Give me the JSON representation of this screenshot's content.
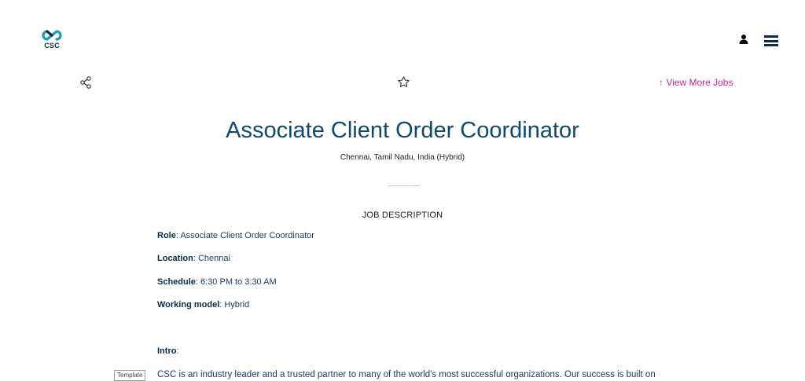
{
  "header": {
    "logo_text": "CSC",
    "user_icon": "user-icon",
    "menu_icon": "hamburger-menu-icon"
  },
  "toolbar": {
    "share_icon": "share-icon",
    "favorite_icon": "star-icon",
    "view_more_label": "↑ View More Jobs"
  },
  "job": {
    "title": "Associate Client Order Coordinator",
    "location": "Chennai, Tamil Nadu, India (Hybrid)"
  },
  "description": {
    "heading": "JOB DESCRIPTION",
    "role_label": "Role",
    "role_value": ": Associate Client Order Coordinator",
    "location_label": "Location",
    "location_value": ": Chennai",
    "schedule_label": "Schedule",
    "schedule_value": ": 6:30 PM to 3:30 AM",
    "working_model_label": "Working model",
    "working_model_value": ": Hybrid",
    "intro_label": "Intro",
    "intro_suffix": ":",
    "intro_text": "CSC is an industry leader and a trusted partner to many of the world's most successful organizations. Our success is built on"
  },
  "template_tag": "Template",
  "colors": {
    "brand_navy": "#0e4a6e",
    "link_magenta": "#d020a0"
  }
}
